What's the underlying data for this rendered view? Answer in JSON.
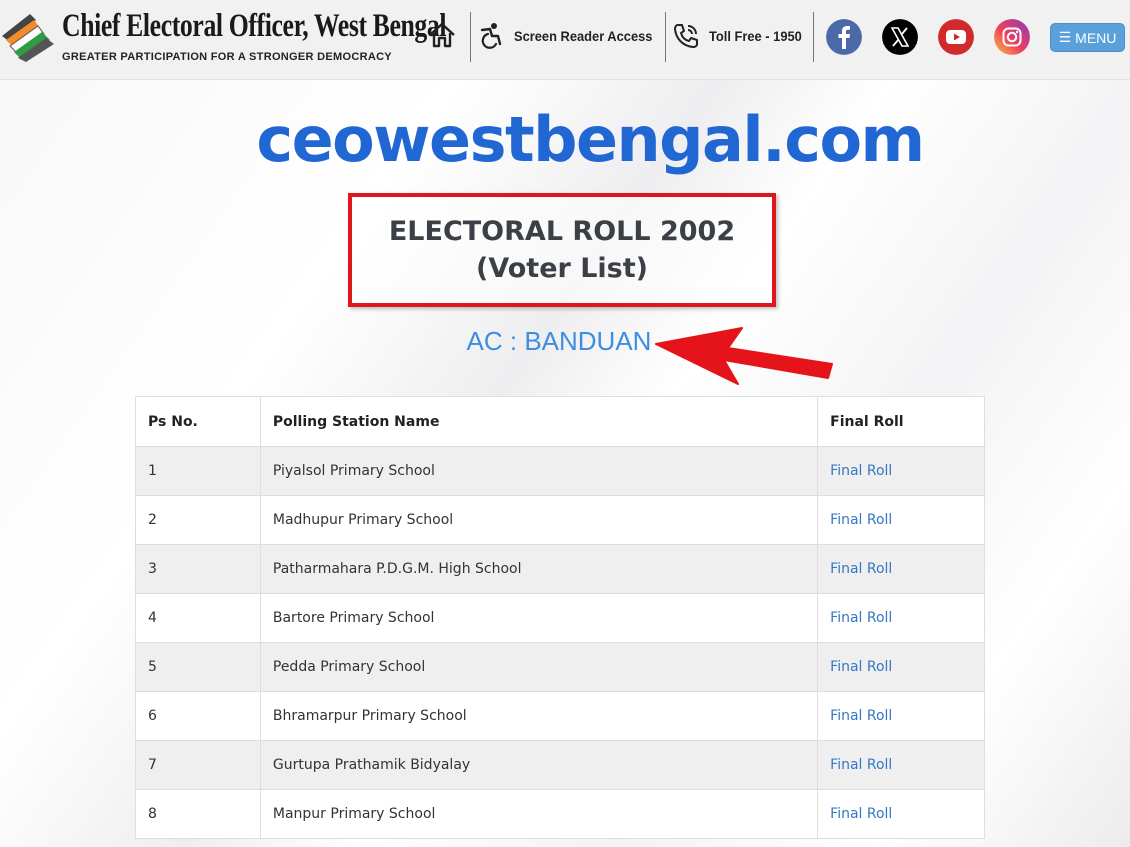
{
  "header": {
    "brand_title": "Chief Electoral Officer, West Bengal",
    "brand_tagline": "GREATER PARTICIPATION FOR A STRONGER DEMOCRACY",
    "screen_reader_label": "Screen Reader Access",
    "toll_free_label": "Toll Free - 1950",
    "menu_label": "MENU",
    "social_icons": [
      "facebook-icon",
      "x-icon",
      "youtube-icon",
      "instagram-icon"
    ]
  },
  "watermark": "ceowestbengal.com",
  "title": {
    "line1": "ELECTORAL ROLL 2002",
    "line2": "(Voter List)"
  },
  "ac_name": "AC : BANDUAN",
  "table": {
    "headers": [
      "Ps No.",
      "Polling Station Name",
      "Final Roll"
    ],
    "rows": [
      {
        "ps_no": "1",
        "name": "Piyalsol Primary School",
        "roll": "Final Roll"
      },
      {
        "ps_no": "2",
        "name": "Madhupur Primary School",
        "roll": "Final Roll"
      },
      {
        "ps_no": "3",
        "name": "Patharmahara P.D.G.M. High School",
        "roll": "Final Roll"
      },
      {
        "ps_no": "4",
        "name": "Bartore Primary School",
        "roll": "Final Roll"
      },
      {
        "ps_no": "5",
        "name": "Pedda Primary School",
        "roll": "Final Roll"
      },
      {
        "ps_no": "6",
        "name": "Bhramarpur Primary School",
        "roll": "Final Roll"
      },
      {
        "ps_no": "7",
        "name": "Gurtupa Prathamik Bidyalay",
        "roll": "Final Roll"
      },
      {
        "ps_no": "8",
        "name": "Manpur Primary School",
        "roll": "Final Roll"
      }
    ]
  },
  "colors": {
    "accent_blue": "#2067d4",
    "link_blue": "#3478c6",
    "highlight_red": "#e0161c",
    "menu_blue": "#5aa0db"
  }
}
